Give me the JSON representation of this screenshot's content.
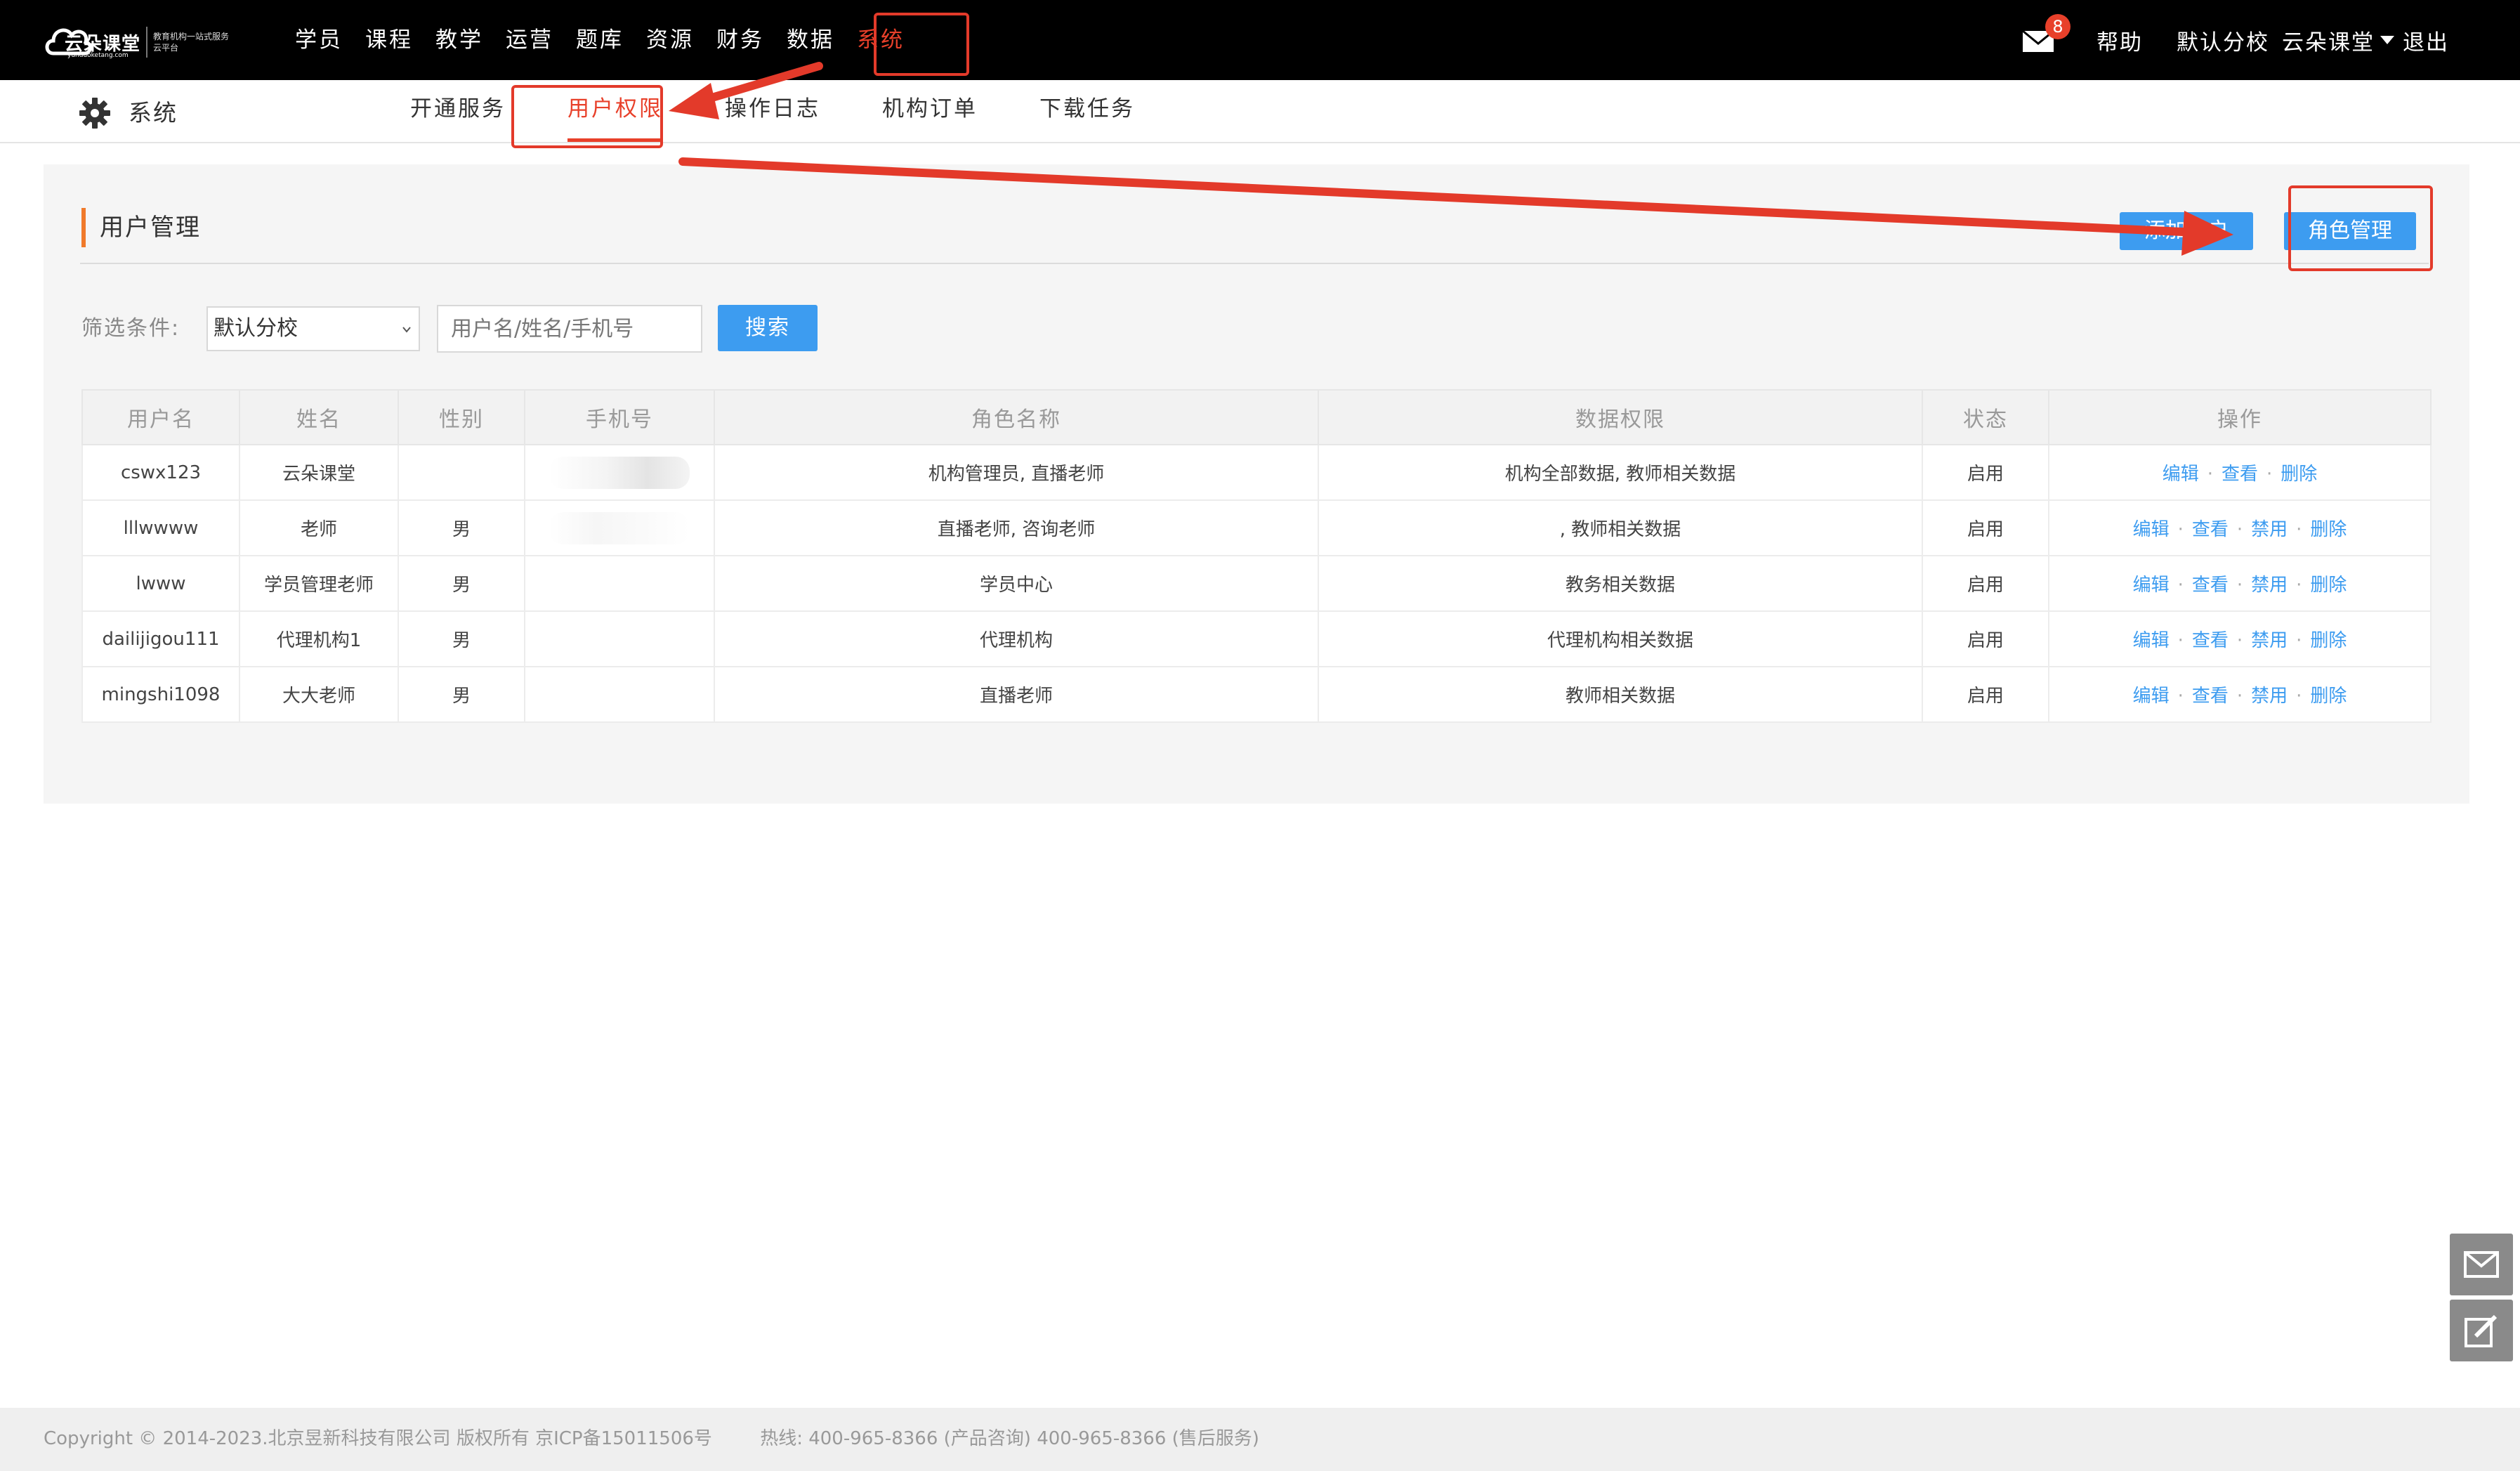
{
  "brand": {
    "name": "云朵课堂",
    "url": "yunduoketang.com",
    "slogan": "教育机构一站式服务云平台"
  },
  "main_nav": [
    "学员",
    "课程",
    "教学",
    "运营",
    "题库",
    "资源",
    "财务",
    "数据",
    "系统"
  ],
  "main_nav_active": "系统",
  "header_right": {
    "mail_badge": "8",
    "help": "帮助",
    "campus": "默认分校",
    "user": "云朵课堂",
    "logout": "退出"
  },
  "sub_header": {
    "title": "系统",
    "tabs": [
      "开通服务",
      "用户权限",
      "操作日志",
      "机构订单",
      "下载任务"
    ],
    "active_tab": "用户权限"
  },
  "section": {
    "title": "用户管理",
    "add_user_button": "添加用户",
    "role_manage_button": "角色管理"
  },
  "filter": {
    "label": "筛选条件:",
    "campus_select": "默认分校",
    "search_placeholder": "用户名/姓名/手机号",
    "search_button": "搜索"
  },
  "table": {
    "headers": [
      "用户名",
      "姓名",
      "性别",
      "手机号",
      "角色名称",
      "数据权限",
      "状态",
      "操作"
    ],
    "rows": [
      {
        "username": "cswx123",
        "name": "云朵课堂",
        "gender": "",
        "phone": "",
        "roles": "机构管理员, 直播老师",
        "data_scope": "机构全部数据, 教师相关数据",
        "status": "启用",
        "ops": [
          "编辑",
          "查看",
          "删除"
        ]
      },
      {
        "username": "lllwwww",
        "name": "老师",
        "gender": "男",
        "phone": "",
        "roles": "直播老师, 咨询老师",
        "data_scope": ", 教师相关数据",
        "status": "启用",
        "ops": [
          "编辑",
          "查看",
          "禁用",
          "删除"
        ]
      },
      {
        "username": "lwww",
        "name": "学员管理老师",
        "gender": "男",
        "phone": "",
        "roles": "学员中心",
        "data_scope": "教务相关数据",
        "status": "启用",
        "ops": [
          "编辑",
          "查看",
          "禁用",
          "删除"
        ]
      },
      {
        "username": "dailijigou111",
        "name": "代理机构1",
        "gender": "男",
        "phone": "",
        "roles": "代理机构",
        "data_scope": "代理机构相关数据",
        "status": "启用",
        "ops": [
          "编辑",
          "查看",
          "禁用",
          "删除"
        ]
      },
      {
        "username": "mingshi1098",
        "name": "大大老师",
        "gender": "男",
        "phone": "",
        "roles": "直播老师",
        "data_scope": "教师相关数据",
        "status": "启用",
        "ops": [
          "编辑",
          "查看",
          "禁用",
          "删除"
        ]
      }
    ]
  },
  "footer": {
    "copyright": "Copyright © 2014-2023.北京昱新科技有限公司 版权所有 京ICP备15011506号",
    "hotline": "热线:  400-965-8366 (产品咨询)  400-965-8366 (售后服务)"
  },
  "icons": {
    "mail": "mail-icon",
    "gear": "gear-icon",
    "feedback": "edit-icon"
  },
  "colors": {
    "accent": "#e8402a",
    "primary_button": "#3d9cf0",
    "section_marker": "#f07a2b",
    "annotation": "#e33a2a"
  }
}
